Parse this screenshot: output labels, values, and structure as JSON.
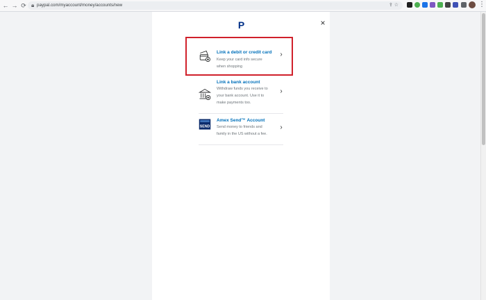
{
  "browser": {
    "url": "paypal.com/myaccount/money/accounts/new"
  },
  "modal": {
    "logo_text": "P",
    "close_label": "×",
    "options": [
      {
        "title": "Link a debit or credit card",
        "description": "Keep your card info secure when shopping",
        "icon": "card-icon"
      },
      {
        "title": "Link a bank account",
        "description": "Withdraw funds you receive to your bank account. Use it to make payments too.",
        "icon": "bank-icon"
      },
      {
        "title": "Amex Send™ Account",
        "description": "Send money to friends and family in the US without a fee.",
        "icon": "amex-send-icon"
      }
    ]
  },
  "colors": {
    "page_bg": "#f2f3f5",
    "modal_bg": "#ffffff",
    "link_blue": "#0070ba",
    "highlight_red": "#d0202a",
    "amex_blue": "#0b2b6b"
  }
}
